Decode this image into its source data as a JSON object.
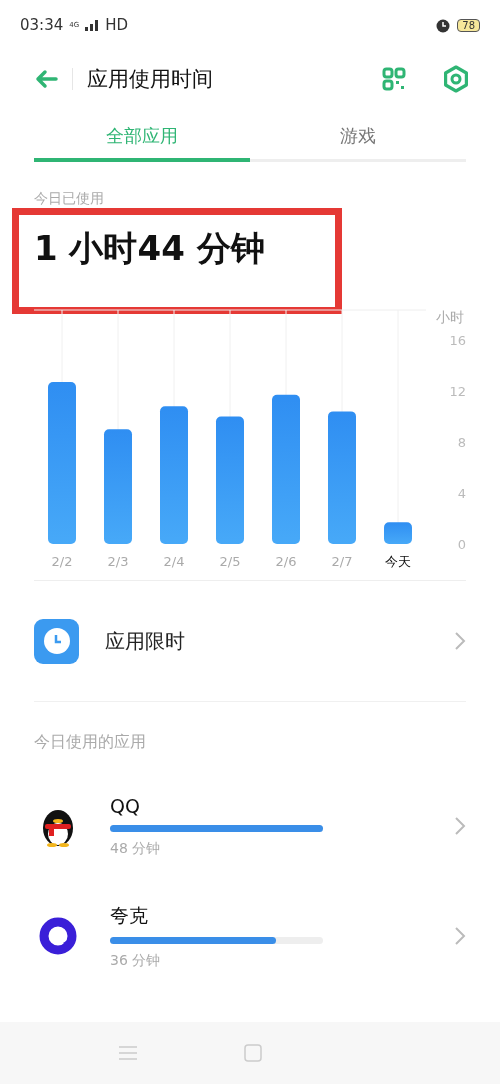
{
  "status_bar": {
    "time": "03:34",
    "network": "4G",
    "hd": "HD",
    "battery": "78"
  },
  "header": {
    "title": "应用使用时间"
  },
  "tabs": [
    {
      "label": "全部应用",
      "selected": true
    },
    {
      "label": "游戏",
      "selected": false
    }
  ],
  "summary": {
    "label": "今日已使用",
    "value": "1 小时44 分钟",
    "highlighted": true
  },
  "usage_chart": {
    "chart_data": {
      "type": "bar",
      "ylabel": "小时",
      "categories": [
        "2/2",
        "2/3",
        "2/4",
        "2/5",
        "2/6",
        "2/7",
        "今天"
      ],
      "values": [
        12.7,
        9.0,
        10.8,
        10.0,
        11.7,
        10.4,
        1.7
      ],
      "ylim": [
        0,
        16
      ],
      "yticks": [
        0,
        4,
        8,
        12,
        16
      ],
      "grid": true
    }
  },
  "limit_row": {
    "label": "应用限时"
  },
  "apps_section": {
    "title": "今日使用的应用"
  },
  "apps": [
    {
      "name": "QQ",
      "duration": "48 分钟",
      "level": 1.0,
      "kind": "penguin"
    },
    {
      "name": "夸克",
      "duration": "36 分钟",
      "level": 0.78,
      "kind": "ring"
    }
  ]
}
